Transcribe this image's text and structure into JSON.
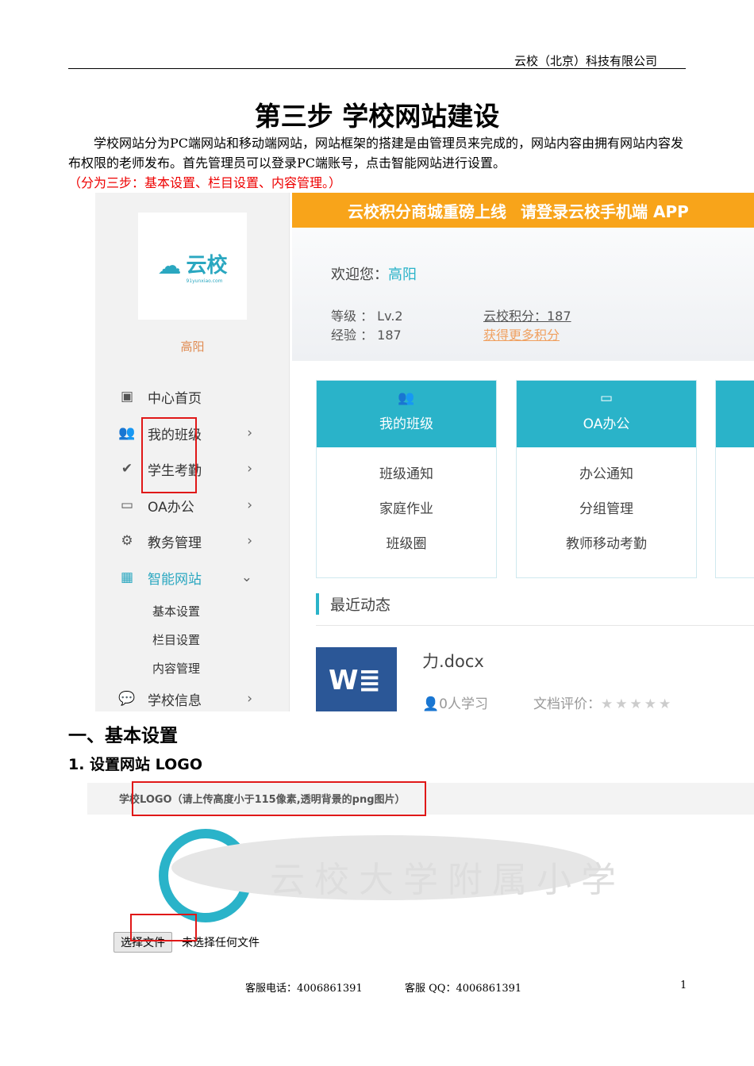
{
  "header": {
    "company": "云校（北京）科技有限公司"
  },
  "title": "第三步  学校网站建设",
  "intro": {
    "text": "学校网站分为PC端网站和移动端网站，网站框架的搭建是由管理员来完成的，网站内容由拥有网站内容发布权限的老师发布。首先管理员可以登录PC端账号，点击智能网站进行设置。",
    "note": "（分为三步：基本设置、栏目设置、内容管理。）"
  },
  "screenshot1": {
    "logo": {
      "name": "云校",
      "domain": "91yunxiao.com"
    },
    "username": "高阳",
    "menu": [
      {
        "label": "中心首页",
        "icon": "user-card-icon"
      },
      {
        "label": "我的班级",
        "icon": "users-icon"
      },
      {
        "label": "学生考勤",
        "icon": "check-circle-icon"
      },
      {
        "label": "OA办公",
        "icon": "monitor-icon"
      },
      {
        "label": "教务管理",
        "icon": "gear-icon"
      },
      {
        "label": "智能网站",
        "icon": "grid-icon"
      },
      {
        "label": "学校信息",
        "icon": "chat-icon"
      }
    ],
    "submenu": [
      "基本设置",
      "栏目设置",
      "内容管理"
    ],
    "banner": [
      "云校积分商城重磅上线",
      "请登录云校手机端 APP"
    ],
    "welcome_label": "欢迎您：",
    "welcome_name": "高阳",
    "level_label": "等级 ： Lv.2",
    "exp_label": "经验 ： 187",
    "points_label": "云校积分：187",
    "more_points": "获得更多积分",
    "cards": [
      {
        "title": "我的班级",
        "items": [
          "班级通知",
          "家庭作业",
          "班级圈"
        ]
      },
      {
        "title": "OA办公",
        "items": [
          "办公通知",
          "分组管理",
          "教师移动考勤"
        ]
      }
    ],
    "recent_title": "最近动态",
    "doc": {
      "name": "力.docx",
      "learners": "0人学习",
      "rating_label": "文档评价：",
      "rating": 0
    }
  },
  "section1": "一、基本设置",
  "step1": "1.  设置网站 LOGO",
  "screenshot2": {
    "label": "学校LOGO（请上传高度小于115像素,透明背景的png图片）",
    "school_name": "云校大学附属小学",
    "choose_btn": "选择文件",
    "no_file": "未选择任何文件"
  },
  "footer": {
    "phone": "客服电话：4006861391",
    "qq": "客服 QQ：4006861391",
    "page": "1"
  }
}
